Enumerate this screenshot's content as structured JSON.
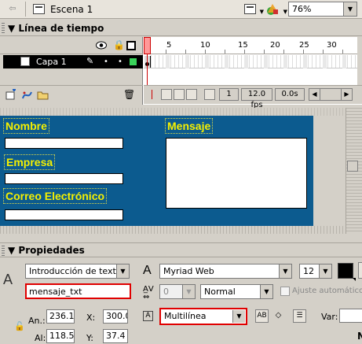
{
  "scene_bar": {
    "scene_label": "Escena 1",
    "zoom": "76%",
    "icons": [
      "back-arrow-icon",
      "scene-icon",
      "edit-symbols-icon",
      "edit-objects-icon"
    ]
  },
  "timeline": {
    "title": "Línea de tiempo",
    "layer": {
      "name": "Capa 1",
      "outline_color": "#3ad35a"
    },
    "ruler_numbers": [
      "1",
      "5",
      "10",
      "15",
      "20",
      "25",
      "30"
    ],
    "current_frame": "1",
    "fps": "12.0 fps",
    "time": "0.0s"
  },
  "stage": {
    "background": "#0c5b8f",
    "label_color": "#f5f000",
    "labels": {
      "nombre": "Nombre",
      "empresa": "Empresa",
      "correo": "Correo Electrónico",
      "mensaje": "Mensaje"
    }
  },
  "properties": {
    "title": "Propiedades",
    "text_type": "Introducción de texto",
    "instance_name": "mensaje_txt",
    "font": "Myriad Web",
    "font_size": "12",
    "tracking": "0",
    "char_position": "Normal",
    "auto_kern_label": "Ajuste automático",
    "line_type": "Multilínea",
    "var_label": "Var:",
    "an_label": "An.:",
    "al_label": "Al:",
    "x_label": "X:",
    "y_label": "Y:",
    "width": "236.1",
    "height": "118.5",
    "x": "300.0",
    "y": "37.4",
    "n_label": "N",
    "highlight_color": "#e00000"
  }
}
